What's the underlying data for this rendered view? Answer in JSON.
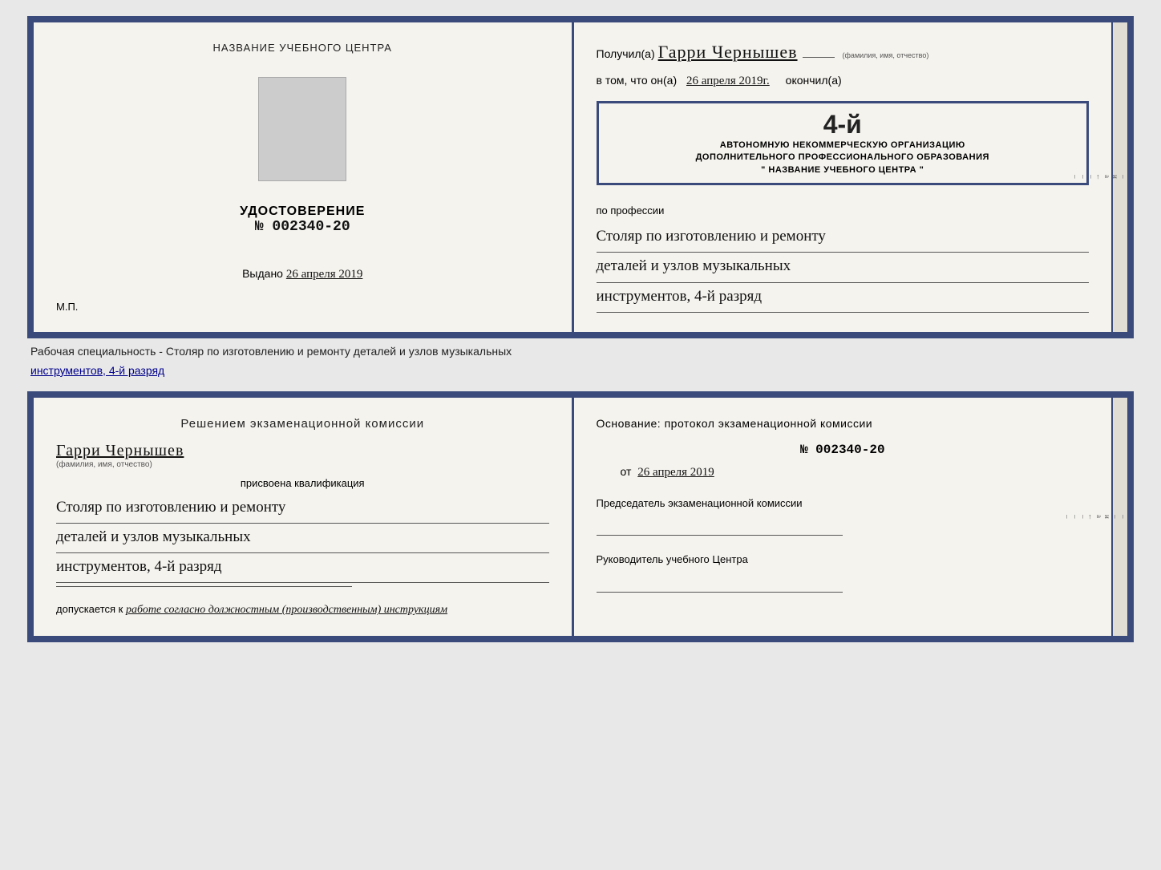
{
  "page": {
    "background": "#e8e8e8"
  },
  "diploma": {
    "left": {
      "center_title": "НАЗВАНИЕ УЧЕБНОГО ЦЕНТРА",
      "udostoverenie_label": "УДОСТОВЕРЕНИЕ",
      "number": "№ 002340-20",
      "vydano_label": "Выдано",
      "vydano_date": "26 апреля 2019",
      "mp_label": "М.П."
    },
    "right": {
      "poluchil_label": "Получил(a)",
      "recipient_name": "Гарри Чернышев",
      "fio_label": "(фамилия, имя, отчество)",
      "vtom_label": "в том, что он(а)",
      "date_issued": "26 апреля 2019г.",
      "okonchil_label": "окончил(а)",
      "stamp_year": "4-й",
      "stamp_line1": "АВТОНОМНУЮ НЕКОММЕРЧЕСКУЮ ОРГАНИЗАЦИЮ",
      "stamp_line2": "ДОПОЛНИТЕЛЬНОГО ПРОФЕССИОНАЛЬНОГО ОБРАЗОВАНИЯ",
      "stamp_line3": "\" НАЗВАНИЕ УЧЕБНОГО ЦЕНТРА \"",
      "po_professii_label": "по профессии",
      "profession_line1": "Столяр по изготовлению и ремонту",
      "profession_line2": "деталей и узлов музыкальных",
      "profession_line3": "инструментов, 4-й разряд"
    }
  },
  "caption": {
    "text": "Рабочая специальность - Столяр по изготовлению и ремонту деталей и узлов музыкальных",
    "text2": "инструментов, 4-й разряд"
  },
  "booklet": {
    "left": {
      "heading": "Решением экзаменационной комиссии",
      "person_name": "Гарри Чернышев",
      "fio_label": "(фамилия, имя, отчество)",
      "prisvoena_label": "присвоена квалификация",
      "qualification_line1": "Столяр по изготовлению и ремонту",
      "qualification_line2": "деталей и узлов музыкальных",
      "qualification_line3": "инструментов, 4-й разряд",
      "dopuskaetsya_prefix": "допускается к",
      "dopuskaetsya_text": "работе согласно должностным (производственным) инструкциям"
    },
    "right": {
      "osnovanie_label": "Основание: протокол экзаменационной комиссии",
      "number": "№ 002340-20",
      "ot_label": "от",
      "ot_date": "26 апреля 2019",
      "chairman_label": "Председатель экзаменационной комиссии",
      "rukovoditel_label": "Руководитель учебного Центра"
    }
  },
  "edge": {
    "labels": [
      "и",
      "а",
      "←",
      "–",
      "–",
      "–",
      "–"
    ]
  }
}
